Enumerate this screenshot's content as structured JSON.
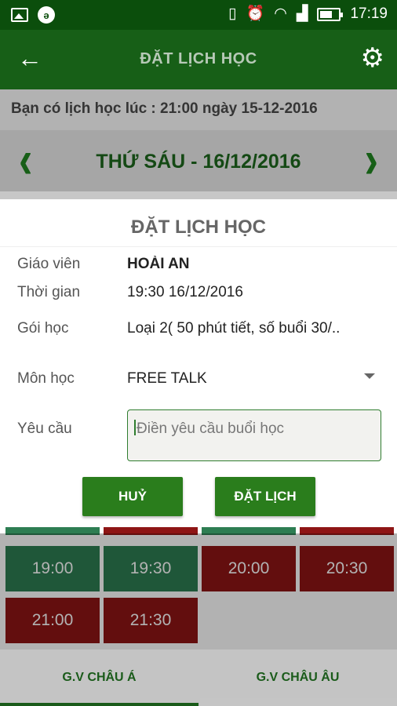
{
  "status_bar": {
    "time": "17:19",
    "icons": [
      "image-icon",
      "app-notification-icon",
      "vibrate-icon",
      "alarm-icon",
      "wifi-icon",
      "signal-icon",
      "battery-icon"
    ]
  },
  "app_bar": {
    "title": "ĐẶT LỊCH HỌC",
    "back_icon": "arrow-left-icon",
    "settings_icon": "gear-icon"
  },
  "notice": "Bạn có lịch học lúc : 21:00 ngày 15-12-2016",
  "day_nav": {
    "date": "THỨ SÁU - 16/12/2016",
    "prev_icon": "chevron-left-icon",
    "next_icon": "chevron-right-icon"
  },
  "dialog": {
    "title": "ĐẶT LỊCH HỌC",
    "teacher_label": "Giáo viên",
    "teacher_value": "HOÀI AN",
    "time_label": "Thời gian",
    "time_value": "19:30 16/12/2016",
    "package_label": "Gói học",
    "package_value": "Loại 2( 50 phút tiết, số buổi 30/..",
    "subject_label": "Môn học",
    "subject_value": "FREE TALK",
    "request_label": "Yêu cầu",
    "request_placeholder": "Điền yêu cầu buổi học",
    "cancel_label": "HUỶ",
    "book_label": "ĐẶT LỊCH"
  },
  "slots": [
    {
      "time": "19:00",
      "status": "available"
    },
    {
      "time": "19:30",
      "status": "available"
    },
    {
      "time": "20:00",
      "status": "booked"
    },
    {
      "time": "20:30",
      "status": "booked"
    },
    {
      "time": "21:00",
      "status": "booked"
    },
    {
      "time": "21:30",
      "status": "booked"
    }
  ],
  "tabs": [
    {
      "label": "G.V CHÂU Á",
      "active": true
    },
    {
      "label": "G.V CHÂU ÂU",
      "active": false
    }
  ],
  "colors": {
    "primary": "#175f17",
    "button": "#2a7d1c",
    "slot_available": "#2d7d52",
    "slot_booked": "#8e1515"
  }
}
